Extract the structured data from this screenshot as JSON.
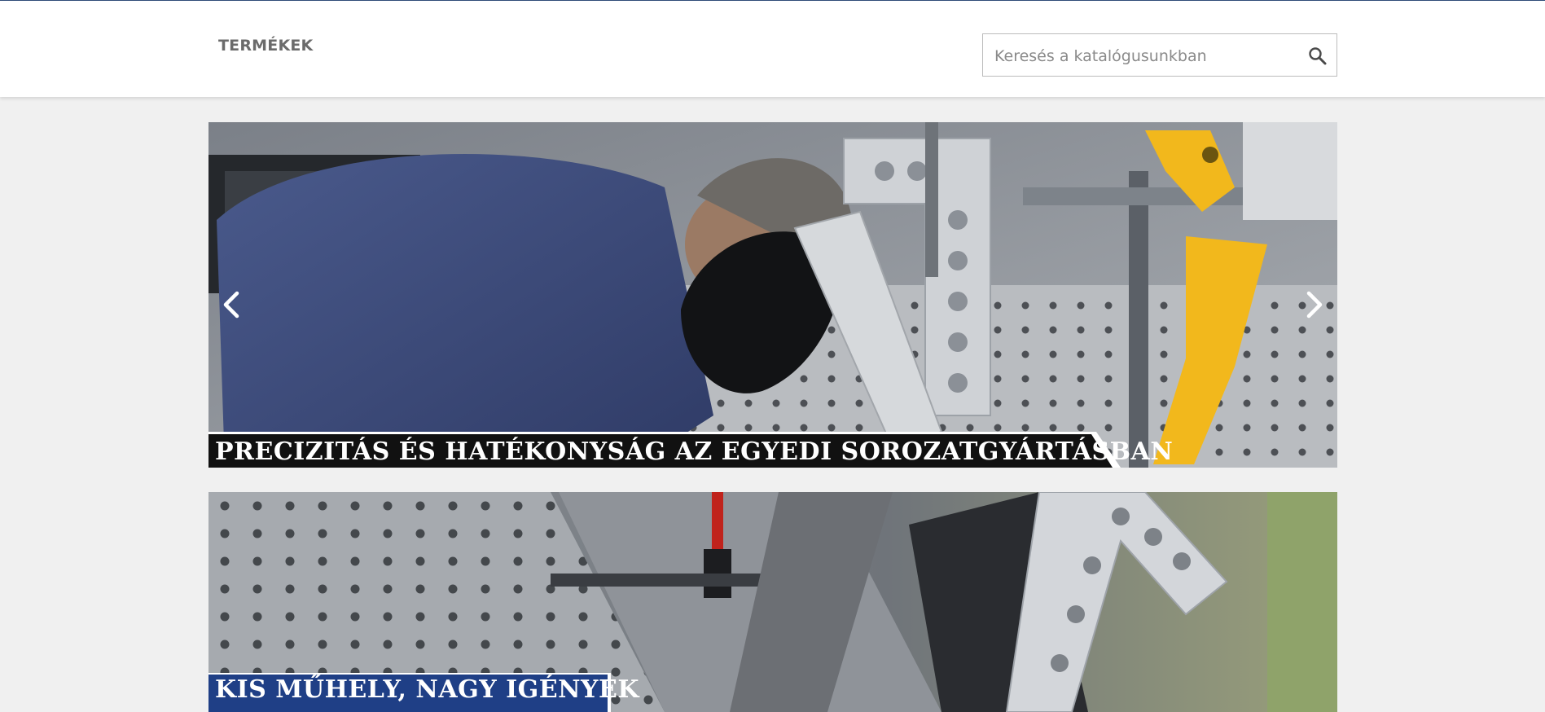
{
  "header": {
    "nav": {
      "products_label": "TERMÉKEK"
    },
    "search": {
      "placeholder": "Keresés a katalógusunkban",
      "value": ""
    }
  },
  "carousel": {
    "slides": [
      {
        "caption": "PRECIZITÁS ÉS HATÉKONYSÁG AZ EGYEDI SOROZATGYÁRTÁSBAN"
      }
    ],
    "prev_icon": "chevron-left-icon",
    "next_icon": "chevron-right-icon"
  },
  "banner": {
    "caption": "KIS MŰHELY, NAGY IGÉNYEK"
  },
  "colors": {
    "accent_blue": "#2f4d7a",
    "caption_bg": "#111111",
    "banner_caption_bg": "#1f3f86",
    "clamp_yellow": "#f2b81c"
  }
}
